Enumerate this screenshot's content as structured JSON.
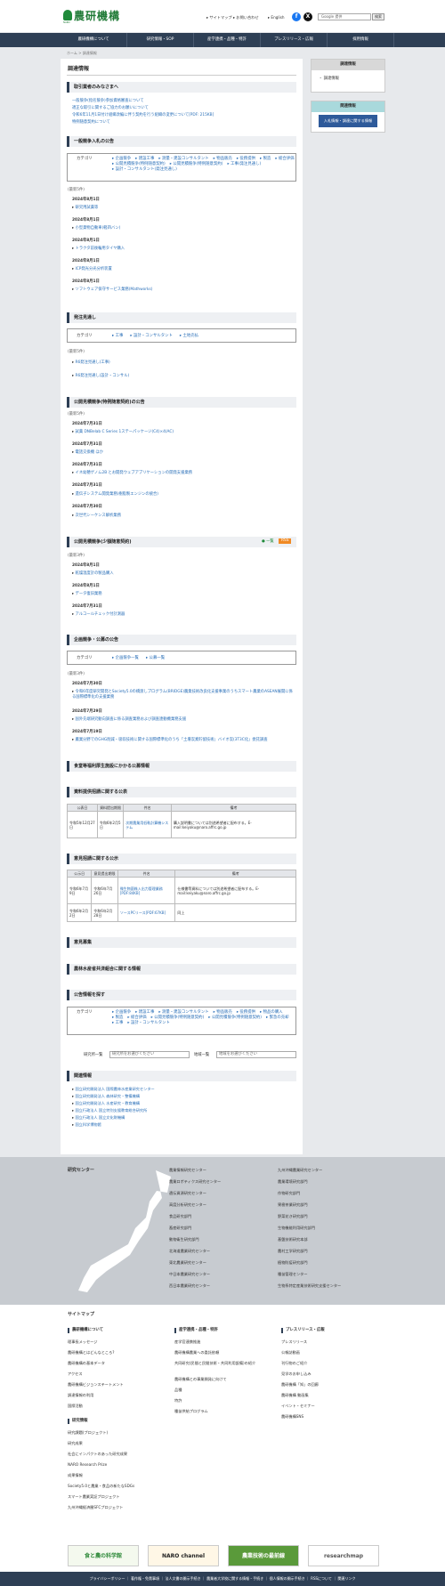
{
  "header": {
    "logo_text": "農研機構",
    "logo_sub": "NARO",
    "links": [
      "▸ サイトマップ",
      "▸ お問い合わせ",
      "▸ English"
    ],
    "search_placeholder": "Google 提供",
    "search_button": "検索"
  },
  "gnav": [
    "農研機構について",
    "研究情報・SOP",
    "産学連携・品種・特許",
    "プレスリリース・広報",
    "採用情報"
  ],
  "breadcrumb": "ホーム > 調達情報",
  "page_title": "調達情報",
  "notice": {
    "heading": "取引業者のみなさまへ",
    "links": [
      "一般競争(指名競争)参加資格審査について",
      "適正な取引に関するご協力のお願いについて",
      "令和6年11月1日付け組織改編に伴う契約を行う組織の変更について[PDF: 215KB]",
      "特例随意契約について"
    ]
  },
  "general": {
    "heading": "一般競争入札の公告",
    "cat_label": "カテゴリ",
    "cats": [
      "▸ 企画競争",
      "▸ 建設工事",
      "▸ 測量・建設コンサルタント",
      "▸ 物品販売",
      "▸ 役務提供",
      "▸ 製造",
      "▸ 総合評価",
      "▸ 公開見積競争(特例随意契約)",
      "▸ 公開見積競争(特例随意契約)",
      "▸ 工事(発注見通し)",
      "▸ 設計・コンサルタント(発注見通し)"
    ],
    "note": "(最新5件)",
    "items": [
      {
        "date": "2024年8月1日",
        "title": "研究用試薬等"
      },
      {
        "date": "2024年8月1日",
        "title": "小型貨物自動車(軽四バン)"
      },
      {
        "date": "2024年8月1日",
        "title": "トラクタ前後輪用タイヤ購入"
      },
      {
        "date": "2024年8月1日",
        "title": "ICP発光分光分析装置"
      },
      {
        "date": "2024年8月1日",
        "title": "ソフトウェア保守サービス業務(Mathworks)"
      }
    ]
  },
  "outlook": {
    "heading": "発注見通し",
    "cat_label": "カテゴリ",
    "cats": [
      "▸ 工事",
      "▸ 設計・コンサルタント",
      "▸ 土地売払"
    ],
    "note": "(最新5件)",
    "items": [
      "R6発注見通し(工事)",
      "R6発注見通し(設計・コンサル)"
    ]
  },
  "open_quote": {
    "heading": "公開見積競争(特例随意契約)の公告",
    "note": "(最新5件)",
    "items": [
      {
        "date": "2024年7月31日",
        "title": "試薬 DNBelab C Series 1ステーパッケージ(C4)×4(AC)"
      },
      {
        "date": "2024年7月31日",
        "title": "電話交換機 ほか"
      },
      {
        "date": "2024年7月31日",
        "title": "イネ幼穂ゲノム2B とお開発ウェブアプリケーションの開発支援業務"
      },
      {
        "date": "2024年7月31日",
        "title": "遺伝子システム開発業務(樹脂製エンジンの統合)"
      },
      {
        "date": "2024年7月30日",
        "title": "次世代シーケンス解析業務"
      }
    ]
  },
  "small_quote": {
    "heading": "公開見積競争(少額随意契約)",
    "tag_list": "● 一覧",
    "tag_rss": "RSS",
    "note": "(最新3件)",
    "items": [
      {
        "date": "2024年8月1日",
        "title": "乾燥温度計の製品購入"
      },
      {
        "date": "2024年8月1日",
        "title": "データ復旧業務"
      },
      {
        "date": "2024年7月31日",
        "title": "アルコールチェック付計測器"
      }
    ]
  },
  "planning": {
    "heading": "企画競争・公募の公告",
    "cat_label": "カテゴリ",
    "cats": [
      "▸ 企画競争一覧",
      "▸ 公募一覧"
    ],
    "note": "(最新3件)",
    "items": [
      {
        "date": "2024年7月30日",
        "title": "令和6年度研究開発とSociety5.0の橋渡しプログラム(BRIDGE)農業技術改良化支援事業のうちスマート農業のASEAN展開に係る国際標準化の支援業務"
      },
      {
        "date": "2024年7月29日",
        "title": "国外先端研究動向調査に係る調査業務および調査連動機業務支援"
      },
      {
        "date": "2024年7月19日",
        "title": "農業分野でのGHG削減・吸収技術に関する国際標準化のうち「土壌炭素貯留技術」バイオ炭(3T3C化」委託調査"
      }
    ]
  },
  "cafeteria": {
    "heading": "食堂等福利厚生施設にかかる公募情報"
  },
  "material": {
    "heading": "資料提供招請に関する公表",
    "headers": [
      "公表日",
      "資料提出期限",
      "件名",
      "備考"
    ],
    "rows": [
      [
        "令和5年12月27日",
        "令和6年2月5日",
        "次期農業用低軌計算機システム",
        "購入説明書については別途希望者に配布する。E-mail:keiyaku@naro.affrc.go.jp"
      ]
    ]
  },
  "opinion": {
    "heading": "意見招請に関する公示",
    "headers": [
      "公示日",
      "意見提出期限",
      "件名",
      "備考"
    ],
    "rows": [
      [
        "令和6年7月9日",
        "令和6年7月26日",
        "微生物菌株入出力管理業務[PDF:84KB]",
        "仕様書等資料については別途希望者に配布する。E-mail:keiyaku@naro.affrc.go.jp"
      ],
      [
        "令和6年2月2日",
        "令和6年2月28日",
        "ソースPCリース[PDF:67KB]",
        "同上"
      ]
    ]
  },
  "opinion_call": {
    "heading": "意見募集"
  },
  "maff": {
    "heading": "農林水産省共済組合に関する情報"
  },
  "search_sec": {
    "heading": "公告情報を探す",
    "cat_label": "カテゴリ",
    "cats": [
      "▸ 企画競争",
      "▸ 建設工事",
      "▸ 測量・建設コンサルタント",
      "▸ 物品販売",
      "▸ 役務提供",
      "▸ 物品の購入",
      "▸ 製造",
      "▸ 総合評価",
      "▸ 公開見積競争(特例随意契約)",
      "▸ 公開見積競争(特例随意契約)",
      "▸ 緊急の売却",
      "▸ 工事",
      "▸ 設計・コンサルタント"
    ],
    "lab_label": "研究所一覧",
    "lab_ph": "研究所をお選びください",
    "area_label": "地域一覧",
    "area_ph": "地域をお選びください"
  },
  "related": {
    "heading": "関連情報",
    "links": [
      "国立研究開発法人 国際農林水産業研究センター",
      "国立研究開発法人 森林研究・整備機構",
      "国立研究開発法人 水産研究・教育機構",
      "国立行政法人 国立特別支援教育総合研究所",
      "国立行政法人 国立文化財機構",
      "国立科学博物館"
    ]
  },
  "side": {
    "box1_title": "調達情報",
    "box1_item": "・ 調達情報",
    "box2_title": "関連情報",
    "banner": "入札情報・調達に関する情報"
  },
  "footer": {
    "heading": "研究センター",
    "col1": [
      "農業情報研究センター",
      "農業ロボティクス研究センター",
      "遺伝資源研究センター",
      "高度分析研究センター",
      "食品研究部門",
      "畜産研究部門",
      "動物衛生研究部門",
      "北海道農業研究センター",
      "東北農業研究センター",
      "中日本農業研究センター",
      "西日本農業研究センター"
    ],
    "col2": [
      "九州沖縄農業研究センター",
      "農業環境研究部門",
      "作物研究部門",
      "果樹茶業研究部門",
      "野菜花き研究部門",
      "生物機能利用研究部門",
      "基盤技術研究本部",
      "農村工学研究部門",
      "植物防疫研究部門",
      "種苗管理センター",
      "生物系特定産業技術研究支援センター"
    ]
  },
  "sitemap": {
    "title": "サイトマップ",
    "h1": "農研機構について",
    "c1": [
      "理事長メッセージ",
      "農研機構とはどんなところ?",
      "農研機構の基本データ",
      "アクセス",
      "農研機構ビジョンステートメント",
      "調達情報の利用",
      "国際活動"
    ],
    "h1b": "研究情報",
    "c1b": [
      "研究課題(プロジェクト)",
      "研究成果",
      "社会にインパクトのあった研究成果",
      "NARO Research Prize",
      "成果情報",
      "Society5.0と農業・食品の新たなSDGs",
      "スマート農業実証プロジェクト",
      "九州沖縄経済圏SFCプロジェクト"
    ],
    "h2": "産学連携・品種・特許",
    "c2": [
      "産学官連携推進",
      "農研機構農業への委託依頼",
      "共同研究(民間と民間技術・共同利用設備)の紹介",
      "農研機構との事業開発に向けて",
      "品種",
      "特許",
      "種苗供給プログラム"
    ],
    "h3": "プレスリリース・広報",
    "c3": [
      "プレスリリース",
      "公報誌動画",
      "刊行物のご紹介",
      "見学のお申し込み",
      "農研機構「知」の回廊",
      "農研機構 動画集",
      "イベント・セミナー",
      "農研機構SNS"
    ]
  },
  "banners": [
    "食と農の科学館",
    "NARO channel",
    "農業技術の最前線",
    "researchmap"
  ],
  "bottom": "プライバシーポリシー ｜ 著作権・免責事項 ｜ 法人文書の開示手続き ｜ 農業者大学校に関する情報・手続き ｜ 個人情報の開示手続き ｜ RSSについて ｜ 関連リンク"
}
